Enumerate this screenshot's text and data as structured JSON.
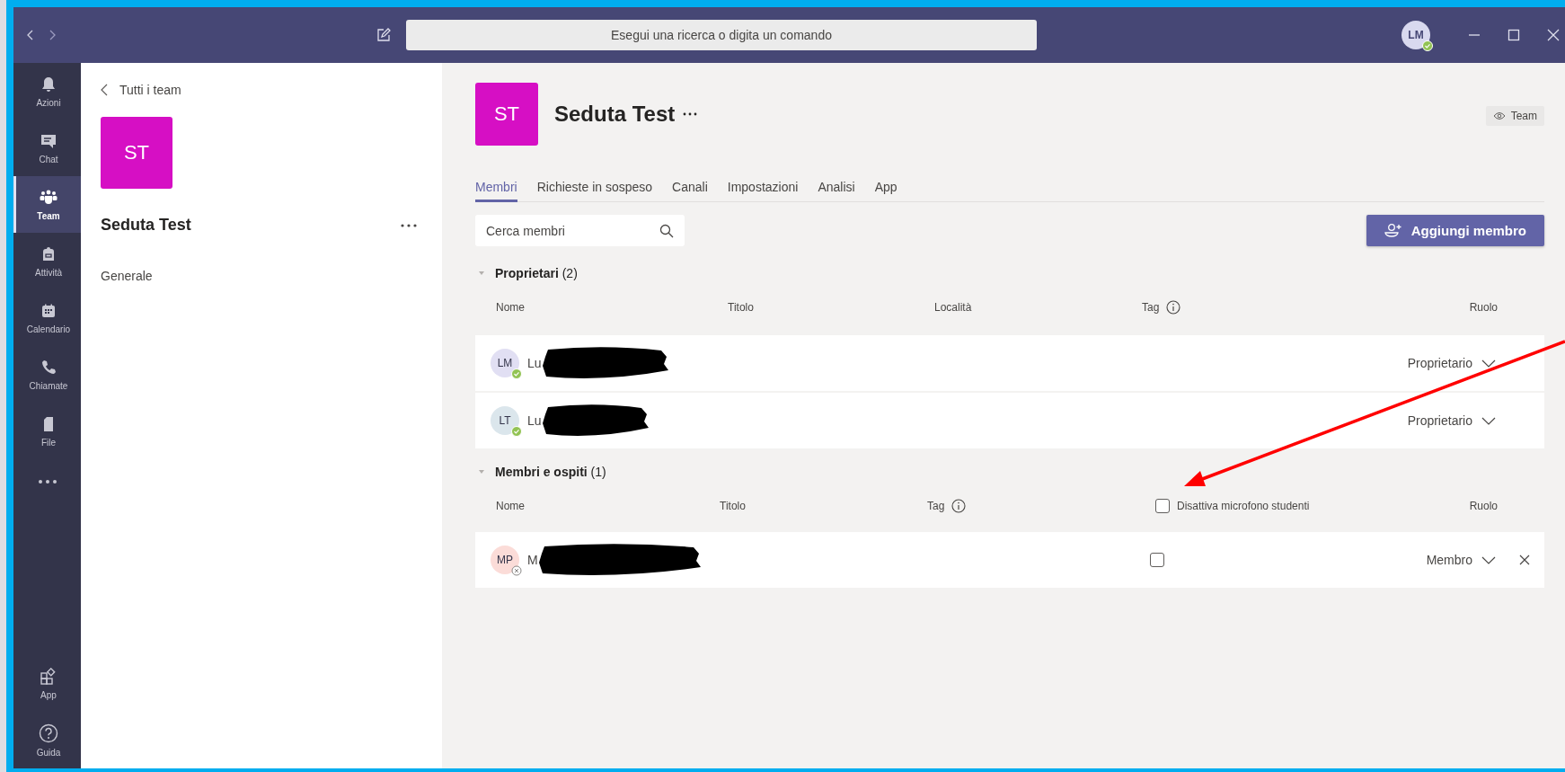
{
  "titlebar": {
    "search_placeholder": "Esegui una ricerca o digita un comando",
    "avatar": "LM",
    "available": true
  },
  "rail": [
    {
      "label": "Azioni",
      "selected": false
    },
    {
      "label": "Chat",
      "selected": false
    },
    {
      "label": "Team",
      "selected": true
    },
    {
      "label": "Attività",
      "selected": false
    },
    {
      "label": "Calendario",
      "selected": false
    },
    {
      "label": "Chiamate",
      "selected": false
    },
    {
      "label": "File",
      "selected": false
    }
  ],
  "rail_bottom": [
    {
      "label": "App"
    },
    {
      "label": "Guida"
    }
  ],
  "sidebar": {
    "back": "Tutti i team",
    "avatar": "ST",
    "team": "Seduta Test",
    "channels": [
      "Generale"
    ]
  },
  "header": {
    "avatar": "ST",
    "title": "Seduta Test",
    "view_badge": "Team"
  },
  "tabs": [
    {
      "label": "Membri",
      "selected": true
    },
    {
      "label": "Richieste in sospeso",
      "selected": false
    },
    {
      "label": "Canali",
      "selected": false
    },
    {
      "label": "Impostazioni",
      "selected": false
    },
    {
      "label": "Analisi",
      "selected": false
    },
    {
      "label": "App",
      "selected": false
    }
  ],
  "search": {
    "placeholder": "Cerca membri"
  },
  "add_button": "Aggiungi membro",
  "sections": [
    {
      "title": "Proprietari",
      "count": "(2)",
      "expanded": true,
      "columns": [
        {
          "kind": "text",
          "label": "Nome"
        },
        {
          "kind": "text",
          "label": "Titolo"
        },
        {
          "kind": "text",
          "label": "Località"
        },
        {
          "kind": "info",
          "label": "Tag"
        },
        {
          "kind": "text",
          "label": "Ruolo"
        }
      ],
      "rows": [
        {
          "initials": "LM",
          "color": "#e1dff3",
          "available": true,
          "name": "Lu",
          "role": "Proprietario",
          "removable": false
        },
        {
          "initials": "LT",
          "color": "#dbe6ec",
          "available": true,
          "name": "Lu",
          "role": "Proprietario",
          "removable": false
        }
      ]
    },
    {
      "title": "Membri e ospiti",
      "count": "(1)",
      "expanded": true,
      "columns": [
        {
          "kind": "text",
          "label": "Nome"
        },
        {
          "kind": "text",
          "label": "Titolo"
        },
        {
          "kind": "info",
          "label": "Tag"
        },
        {
          "kind": "checkbox",
          "label": "Disattiva microfono studenti",
          "checked": false
        },
        {
          "kind": "text",
          "label": "Ruolo"
        }
      ],
      "rows": [
        {
          "initials": "MP",
          "color": "#fbdcd8",
          "available": false,
          "name": "M",
          "mute_checked": false,
          "role": "Membro",
          "removable": true
        }
      ]
    }
  ]
}
